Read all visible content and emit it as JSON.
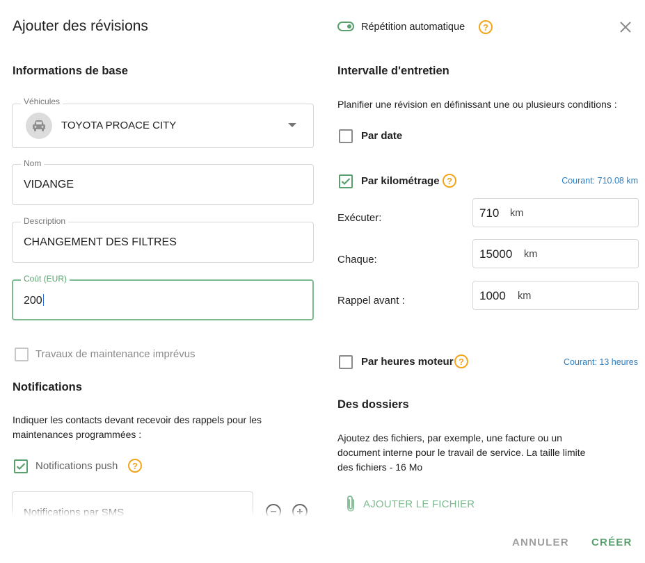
{
  "dialog": {
    "title": "Ajouter des révisions",
    "auto_repeat_label": "Répétition automatique",
    "auto_repeat_on": true
  },
  "basic": {
    "heading": "Informations de base",
    "vehicle_label": "Véhicules",
    "vehicle_value": "TOYOTA PROACE CITY",
    "name_label": "Nom",
    "name_value": "VIDANGE",
    "description_label": "Description",
    "description_value": "CHANGEMENT DES FILTRES",
    "cost_label": "Coût (EUR)",
    "cost_value": "200",
    "unplanned_label": "Travaux de maintenance imprévus"
  },
  "notifications": {
    "heading": "Notifications",
    "intro_line1": "Indiquer les contacts devant recevoir des rappels pour les",
    "intro_line2": "maintenances programmées :",
    "push_label": "Notifications push",
    "push_checked": true,
    "sms_placeholder": "Notifications par SMS"
  },
  "interval": {
    "heading": "Intervalle d'entretien",
    "intro": "Planifier une révision en définissant une ou plusieurs conditions :",
    "by_date_label": "Par date",
    "by_date_checked": false,
    "by_km_label": "Par kilométrage",
    "by_km_checked": true,
    "km_current": "Courant: 710.08 km",
    "execute_label": "Exécuter:",
    "execute_value": "710",
    "every_label": "Chaque:",
    "every_value": "15000",
    "reminder_label": "Rappel avant :",
    "reminder_value": "1000",
    "unit_km": "km",
    "by_hours_label": "Par heures moteur",
    "by_hours_checked": false,
    "hours_current": "Courant: 13 heures"
  },
  "files": {
    "heading": "Des dossiers",
    "intro_line1": "Ajoutez des fichiers, par exemple, une facture ou un",
    "intro_line2": "document interne pour le travail de service. La taille limite",
    "intro_line3": "des fichiers - 16 Mo",
    "attach_label": "AJOUTER LE FICHIER"
  },
  "actions": {
    "cancel_label": "ANNULER",
    "create_label": "CRÉER"
  },
  "colors": {
    "accent_green": "#5aa06f",
    "help_orange": "#f2a51a",
    "link_blue": "#2b7fc4"
  },
  "icons": {
    "close": "close-icon",
    "vehicle": "car-icon",
    "help": "help-circle-icon",
    "attach": "paperclip-icon",
    "remove": "minus-circle-icon",
    "add": "plus-circle-icon"
  }
}
